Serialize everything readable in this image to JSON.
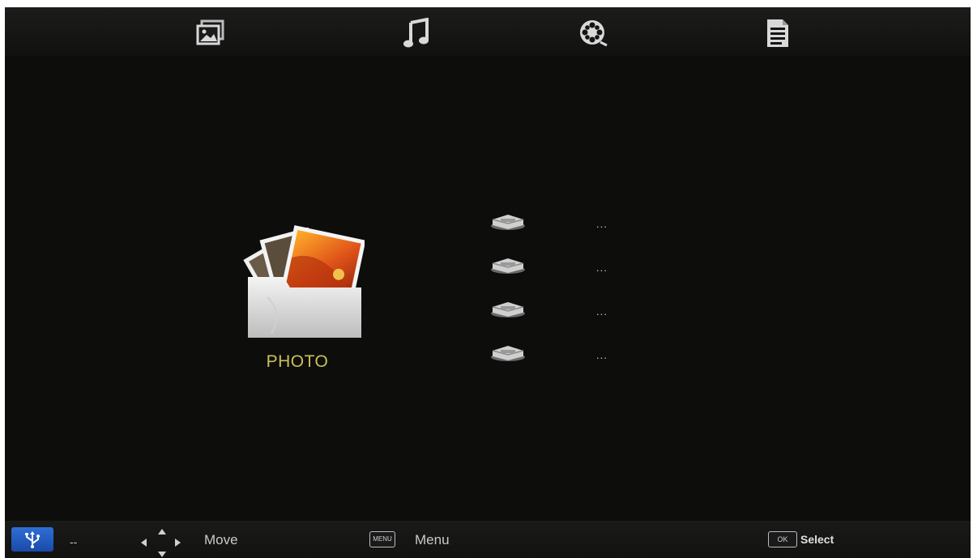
{
  "topbar": {
    "icons": [
      "photo-icon",
      "music-icon",
      "movie-icon",
      "text-icon"
    ]
  },
  "main": {
    "category_label": "PHOTO",
    "devices": [
      {
        "name": "..."
      },
      {
        "name": "..."
      },
      {
        "name": "..."
      },
      {
        "name": "..."
      }
    ]
  },
  "bottombar": {
    "usb_status": "--",
    "move_label": "Move",
    "menu_key": "MENU",
    "menu_label": "Menu",
    "ok_key": "OK",
    "select_label": "Select"
  },
  "colors": {
    "background": "#0d0d0c",
    "label_accent": "#c9c05a",
    "usb_blue": "#2f6fd6"
  }
}
